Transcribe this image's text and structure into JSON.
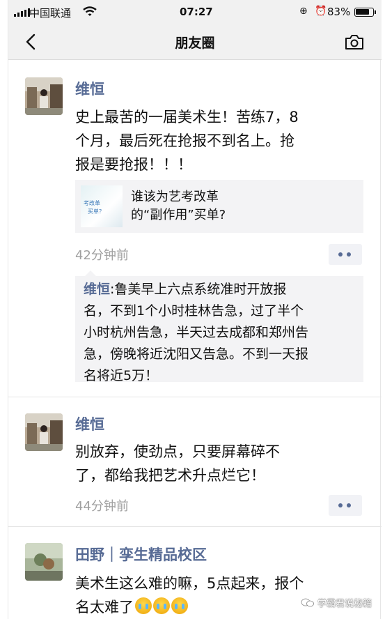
{
  "status_bar": {
    "carrier": "中国联通",
    "time": "07:27",
    "battery": "83%",
    "battery_level": 0.83,
    "icons": [
      "signal-icon",
      "wifi-icon",
      "rotation-lock-icon",
      "alarm-icon",
      "battery-icon"
    ]
  },
  "nav": {
    "title": "朋友圈",
    "back_icon": "chevron-left-icon",
    "camera_icon": "camera-icon"
  },
  "posts": [
    {
      "author": "维恒",
      "text": "史上最苦的一届美术生！苦练7，8\n个月，最后死在抢报不到名上。抢\n报是要抢报！！！",
      "link": {
        "thumb_lines": [
          "考改革",
          "买单？"
        ],
        "title": "谁该为艺考改革\n的“副作用”买单?"
      },
      "time": "42分钟前",
      "comment": {
        "author": "维恒",
        "text": "鲁美早上六点系统准时开放报\n名，不到1个小时桂林告急，过了半个\n小时杭州告急，半天过去成都和郑州告\n急，傍晚将近沈阳又告急。不到一天报\n名将近5万！"
      }
    },
    {
      "author": "维恒",
      "text": "别放弃，使劲点，只要屏幕碎不\n了，都给我把艺术升点烂它！",
      "time": "44分钟前"
    },
    {
      "author": "田野｜孪生精品校区",
      "text_line1": "美术生这么难的嘛，5点起来，报个",
      "text_line2": "名太难了"
    }
  ],
  "watermark": "学霸君说秘籍",
  "colors": {
    "bar_bg": "#f1f1f1",
    "link_blue": "#576b95",
    "card_bg": "#f3f3f5",
    "time_gray": "#a0a0a0"
  }
}
